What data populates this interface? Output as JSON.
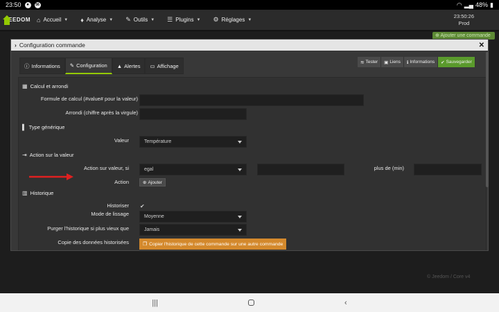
{
  "status_bar": {
    "time": "23:50",
    "notif_badge": "56",
    "battery": "48%"
  },
  "navbar": {
    "logo_text": "EEDOM",
    "items": [
      {
        "label": "Accueil",
        "icon": "home-icon"
      },
      {
        "label": "Analyse",
        "icon": "analysis-icon"
      },
      {
        "label": "Outils",
        "icon": "wrench-icon"
      },
      {
        "label": "Plugins",
        "icon": "list-icon"
      },
      {
        "label": "Réglages",
        "icon": "gear-icon"
      }
    ],
    "clock": "23:50:26",
    "profile": "Prod"
  },
  "background": {
    "add_command_label": "Ajouter une commande",
    "footer": "© Jeedom / Core v4"
  },
  "modal": {
    "title": "Configuration commande",
    "tabs": [
      {
        "label": "Informations",
        "icon": "info-icon"
      },
      {
        "label": "Configuration",
        "icon": "wrench-icon"
      },
      {
        "label": "Alertes",
        "icon": "warning-icon"
      },
      {
        "label": "Affichage",
        "icon": "display-icon"
      }
    ],
    "actions": {
      "test": "Tester",
      "links": "Liens",
      "info": "Informations",
      "save": "Sauvegarder"
    }
  },
  "config": {
    "section_calc": "Calcul et arrondi",
    "formula_label": "Formule de calcul (#value# pour la valeur)",
    "formula_value": "",
    "round_label": "Arrondi (chiffre après la virgule)",
    "round_value": "",
    "section_type": "Type générique",
    "value_label": "Valeur",
    "value_selected": "Température",
    "section_action": "Action sur la valeur",
    "action_if_label": "Action sur valeur, si",
    "action_if_selected": "egal",
    "action_if_value": "",
    "more_than_label": "plus de (min)",
    "more_than_value": "",
    "action_label": "Action",
    "add_button": "Ajouter",
    "section_history": "Historique",
    "historize_label": "Historiser",
    "smoothing_label": "Mode de lissage",
    "smoothing_selected": "Moyenne",
    "purge_label": "Purger l'historique si plus vieux que",
    "purge_selected": "Jamais",
    "copy_label": "Copie des données historisées",
    "copy_button": "Copier l'historique de cette commande sur une autre commande"
  },
  "colors": {
    "accent_green": "#94ca02",
    "save_green": "#5a9a2c",
    "orange": "#d4892c",
    "arrow_red": "#e02020"
  }
}
